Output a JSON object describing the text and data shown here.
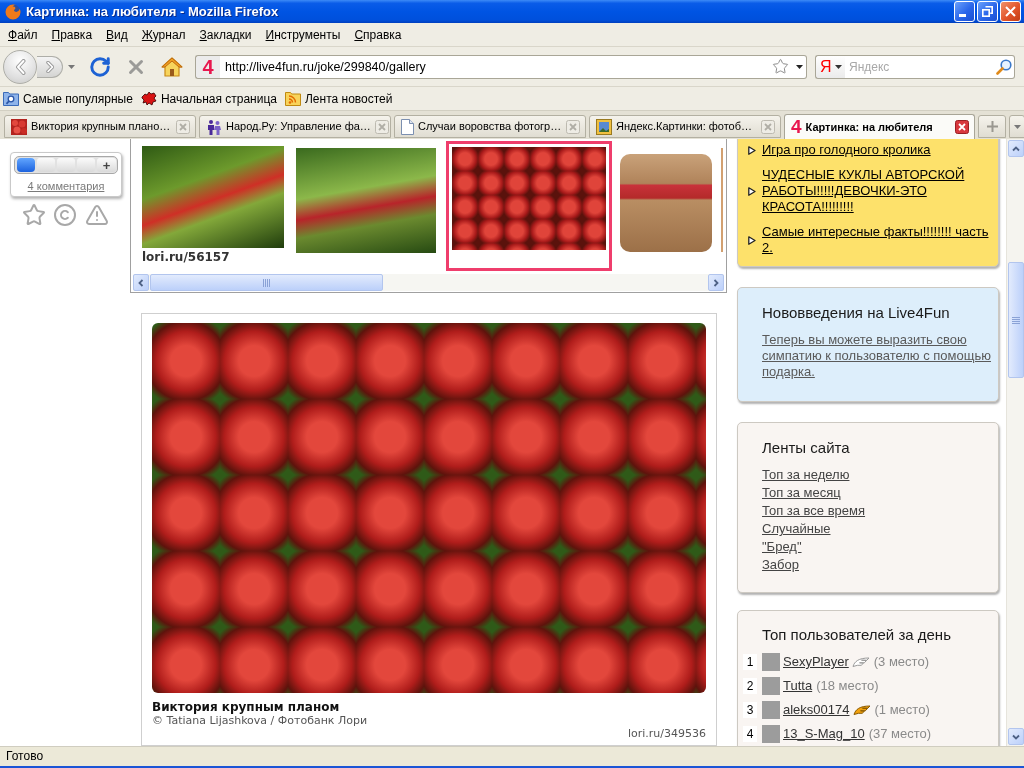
{
  "window": {
    "title": "Картинка: на любителя - Mozilla Firefox"
  },
  "menu": [
    "Файл",
    "Правка",
    "Вид",
    "Журнал",
    "Закладки",
    "Инструменты",
    "Справка"
  ],
  "navigation": {
    "site_badge": "4",
    "url": "http://live4fun.ru/joke/299840/gallery",
    "search": {
      "engine_badge": "Я",
      "placeholder": "Яндекс"
    }
  },
  "bookmarks": [
    {
      "kind": "smart-folder",
      "label": "Самые популярные"
    },
    {
      "kind": "site",
      "label": "Начальная страница"
    },
    {
      "kind": "feed",
      "label": "Лента новостей"
    }
  ],
  "tabs": [
    {
      "kind": "photo",
      "label": "Виктория крупным плано…",
      "selected": false
    },
    {
      "kind": "people",
      "label": "Народ.Ру: Управление фа…",
      "selected": false
    },
    {
      "kind": "page",
      "label": "Случаи воровства фотогр…",
      "selected": false
    },
    {
      "kind": "picture",
      "label": "Яндекс.Картинки: фотоб…",
      "selected": false
    },
    {
      "kind": "badge",
      "badge": "4",
      "label": "Картинка: на любителя",
      "selected": true
    }
  ],
  "rating": {
    "level": 0.25,
    "plus": "+",
    "comments": "4 комментария"
  },
  "gallery": {
    "thumbnails": [
      {
        "kind": "leaves",
        "caption": "lori.ru/56157",
        "selected": false
      },
      {
        "kind": "garden",
        "selected": false
      },
      {
        "kind": "berries",
        "selected": true
      },
      {
        "kind": "basket",
        "selected": false
      },
      {
        "kind": "partial",
        "selected": false
      }
    ]
  },
  "photo": {
    "title": "Виктория крупным планом",
    "credit": "© Tatiana Lijashkova / Фотобанк Лори",
    "source": "lori.ru/349536"
  },
  "sidebar": {
    "links": [
      "Игра про голодного кролика",
      "ЧУДЕСНЫЕ КУКЛЫ АВТОРСКОЙ РАБОТЫ!!!!!ДЕВОЧКИ-ЭТО КРАСОТА!!!!!!!!!",
      "Самые интересные факты!!!!!!!! часть 2."
    ],
    "news": {
      "title": "Нововведения на Live4Fun",
      "text": "Теперь вы можете выразить свою симпатию к пользователю с помощью подарка."
    },
    "feeds": {
      "title": "Ленты сайта",
      "links": [
        "Топ за неделю",
        "Топ за месяц",
        "Топ за все время",
        "Случайные",
        "\"Бред\"",
        "Забор"
      ]
    },
    "top_users": {
      "title": "Топ пользователей за день",
      "rows": [
        {
          "kind": "silver-wing",
          "rank": "1",
          "name": "SexyPlayer",
          "place": "(3 место)"
        },
        {
          "kind": "plain",
          "rank": "2",
          "name": "Tutta",
          "place": "(18 место)"
        },
        {
          "kind": "gold-wing",
          "rank": "3",
          "name": "aleks00174",
          "place": "(1 место)"
        },
        {
          "kind": "plain",
          "rank": "4",
          "name": "13_S-Mag_10",
          "place": "(37 место)"
        }
      ]
    }
  },
  "status_bar": {
    "text": "Готово"
  }
}
